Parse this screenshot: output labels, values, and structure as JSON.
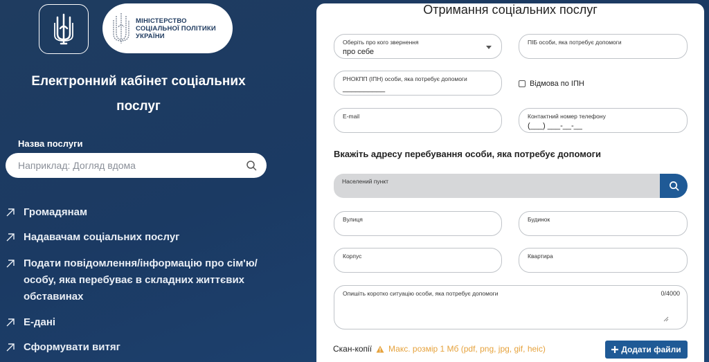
{
  "header": {
    "ministry_line1": "МІНІСТЕРСТВО",
    "ministry_line2": "СОЦІАЛЬНОЇ ПОЛІТИКИ",
    "ministry_line3": "УКРАЇНИ",
    "cabinet_title_line1": "Електронний кабінет соціальних",
    "cabinet_title_line2": "послуг"
  },
  "search": {
    "label": "Назва послуги",
    "placeholder": "Наприклад: Догляд вдома",
    "icon": "search-icon"
  },
  "nav": {
    "items": [
      {
        "label": "Громадянам",
        "icon": "arrow-up-right-icon"
      },
      {
        "label": "Надавачам соціальних послуг",
        "icon": "arrow-up-right-icon"
      },
      {
        "label": "Подати повідомлення/інформацію про сім'ю/ особу, яка перебуває в складних життєвих обставинах",
        "icon": "arrow-up-right-icon"
      },
      {
        "label": "Е-дані",
        "icon": "arrow-up-right-icon"
      },
      {
        "label": "Сформувати витяг",
        "icon": "arrow-up-right-icon"
      }
    ]
  },
  "form": {
    "title": "Отримання соціальних послуг",
    "who_label": "Оберіть про кого звернення",
    "who_value": "про себе",
    "pib_label": "ПІБ особи, яка потребує допомоги",
    "rnokpp_label": "РНОКПП (ІПН) особи, яка потребує допомоги",
    "rnokpp_value": "__________",
    "ipn_refusal_label": "Відмова по ІПН",
    "email_label": "E-mail",
    "phone_label": "Контактний номер телефону",
    "phone_value": "(___) ___-__-__",
    "address_title": "Вкажіть адресу перебування особи, яка потребує допомоги",
    "locality_label": "Населений пункт",
    "street_label": "Вулиця",
    "house_label": "Будинок",
    "building_label": "Корпус",
    "apartment_label": "Квартира",
    "situation_label": "Опишіть коротко ситуацію особи, яка потребує допомоги",
    "situation_counter": "0/4000",
    "scan_label": "Скан-копії",
    "scan_limit": "Макс. розмір 1 Мб (pdf, png, jpg, gif, heic)",
    "add_files_label": "Додати файли"
  },
  "colors": {
    "background": "#1d3a60",
    "accent": "#1f5a96",
    "warning": "#e6a23c"
  }
}
